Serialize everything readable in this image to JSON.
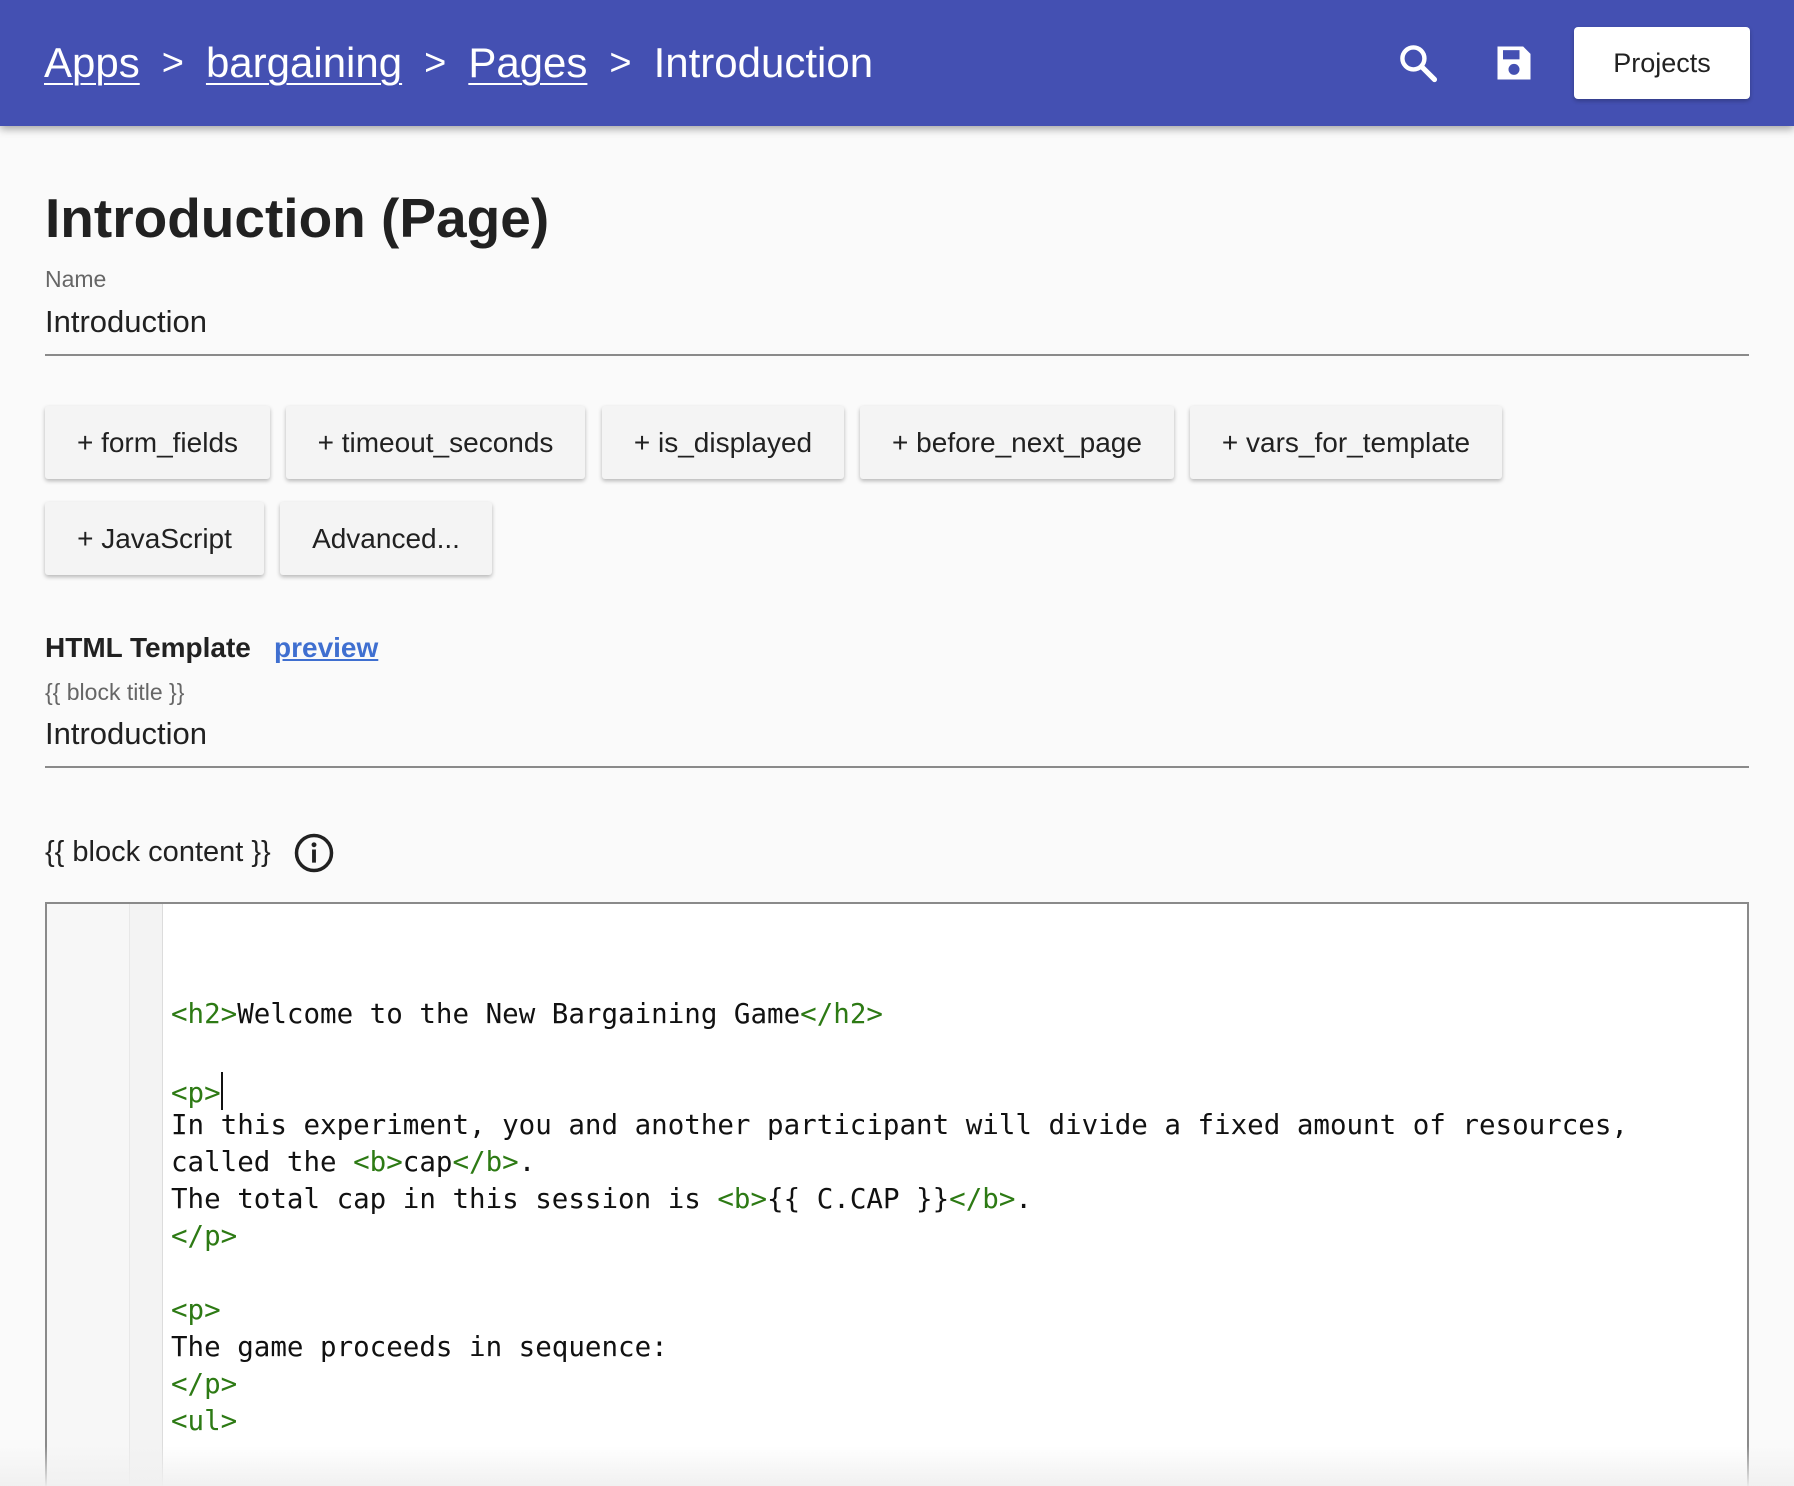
{
  "breadcrumb": {
    "items": [
      {
        "label": "Apps"
      },
      {
        "label": "bargaining"
      },
      {
        "label": "Pages"
      }
    ],
    "separator": ">",
    "current": "Introduction"
  },
  "header": {
    "projects_label": "Projects",
    "search_icon": "search-icon",
    "save_icon": "save-icon",
    "bar_color": "#4450b2"
  },
  "page": {
    "title": "Introduction (Page)",
    "name_label": "Name",
    "name_value": "Introduction"
  },
  "chips": [
    {
      "label": "+ form_fields"
    },
    {
      "label": "+ timeout_seconds"
    },
    {
      "label": "+ is_displayed"
    },
    {
      "label": "+ before_next_page"
    },
    {
      "label": "+ vars_for_template"
    },
    {
      "label": "+ JavaScript"
    },
    {
      "label": "Advanced..."
    }
  ],
  "template": {
    "section_title": "HTML Template",
    "preview_label": "preview",
    "block_title_label": "{{ block title }}",
    "block_title_value": "Introduction",
    "block_content_label": "{{ block content }}",
    "info_icon": "info-icon"
  },
  "code_lines": [
    {
      "segments": [
        {
          "t": "tag",
          "v": "<h2>"
        },
        {
          "t": "txt",
          "v": "Welcome to the New Bargaining Game"
        },
        {
          "t": "tag",
          "v": "</h2>"
        }
      ]
    },
    {
      "segments": [
        {
          "t": "tag",
          "v": "<p>"
        }
      ],
      "cursor": true
    },
    {
      "segments": [
        {
          "t": "txt",
          "v": "In this experiment, you and another participant will divide a fixed amount of resources,"
        }
      ]
    },
    {
      "segments": [
        {
          "t": "txt",
          "v": "called the "
        },
        {
          "t": "tag",
          "v": "<b>"
        },
        {
          "t": "txt",
          "v": "cap"
        },
        {
          "t": "tag",
          "v": "</b>"
        },
        {
          "t": "txt",
          "v": "."
        }
      ]
    },
    {
      "segments": [
        {
          "t": "txt",
          "v": "The total cap in this session is "
        },
        {
          "t": "tag",
          "v": "<b>"
        },
        {
          "t": "txt",
          "v": "{{ C.CAP }}"
        },
        {
          "t": "tag",
          "v": "</b>"
        },
        {
          "t": "txt",
          "v": "."
        }
      ]
    },
    {
      "segments": [
        {
          "t": "tag",
          "v": "</p>"
        }
      ]
    },
    {
      "segments": [
        {
          "t": "tag",
          "v": "<p>"
        }
      ]
    },
    {
      "segments": [
        {
          "t": "txt",
          "v": "The game proceeds in sequence:"
        }
      ]
    },
    {
      "segments": [
        {
          "t": "tag",
          "v": "</p>"
        }
      ]
    },
    {
      "segments": [
        {
          "t": "tag",
          "v": "<ul>"
        }
      ]
    }
  ]
}
